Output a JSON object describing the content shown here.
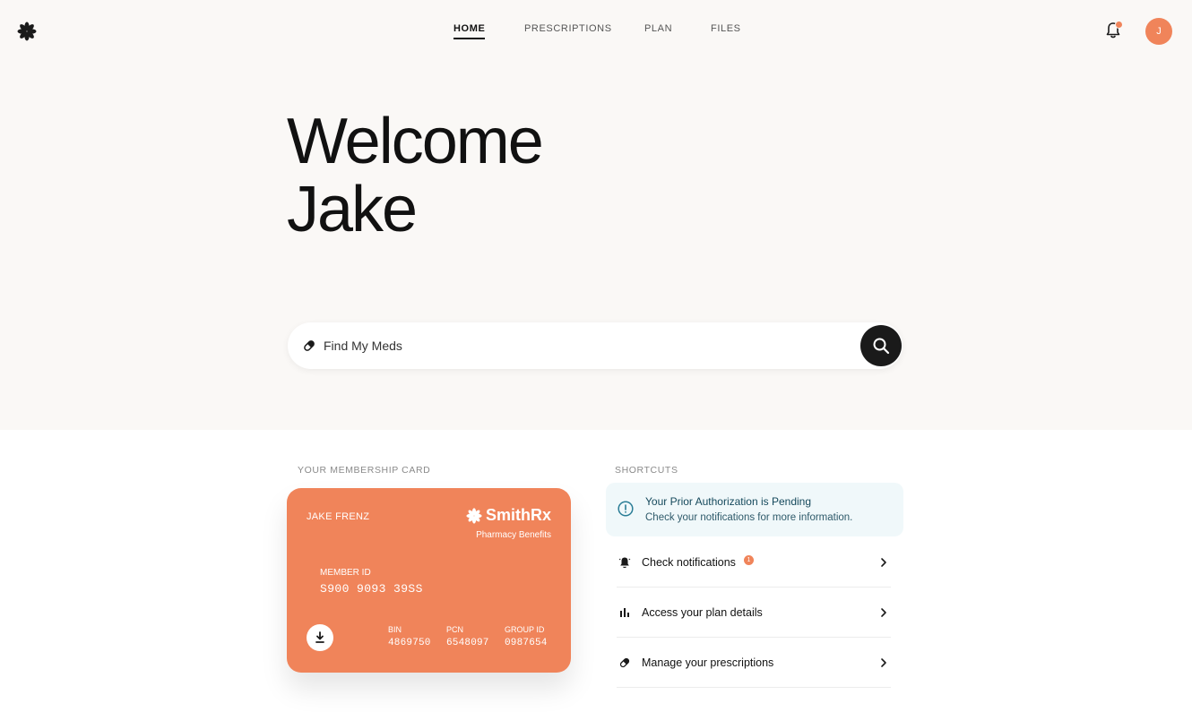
{
  "nav": {
    "items": [
      {
        "label": "HOME",
        "active": true
      },
      {
        "label": "PRESCRIPTIONS",
        "active": false
      },
      {
        "label": "PLAN",
        "active": false
      },
      {
        "label": "FILES",
        "active": false
      }
    ]
  },
  "header": {
    "avatar_initial": "J",
    "notification_icon": "bell-icon"
  },
  "hero": {
    "line1": "Welcome",
    "line2": "Jake"
  },
  "search": {
    "placeholder": "Find My Meds",
    "icon": "pill-icon",
    "button_icon": "search-icon"
  },
  "membership": {
    "section_title": "YOUR MEMBERSHIP CARD",
    "member_name": "JAKE FRENZ",
    "brand_name": "SmithRx",
    "brand_subtitle": "Pharmacy Benefits",
    "member_id_label": "MEMBER ID",
    "member_id": "S900 9093 39SS",
    "bin_label": "BIN",
    "bin": "4869750",
    "pcn_label": "PCN",
    "pcn": "6548097",
    "group_label": "GROUP ID",
    "group_id": "0987654"
  },
  "shortcuts": {
    "section_title": "SHORTCUTS",
    "alert_title": "Your Prior Authorization is Pending",
    "alert_subtitle": "Check your notifications for more information.",
    "items": [
      {
        "label": "Check notifications",
        "icon": "bell-icon",
        "badge": "1"
      },
      {
        "label": "Access your plan details",
        "icon": "bar-chart-icon"
      },
      {
        "label": "Manage your prescriptions",
        "icon": "pill-icon"
      }
    ]
  },
  "colors": {
    "accent": "#f0845a",
    "hero_bg": "#faf8f6",
    "alert_bg": "#f0f8fa"
  }
}
